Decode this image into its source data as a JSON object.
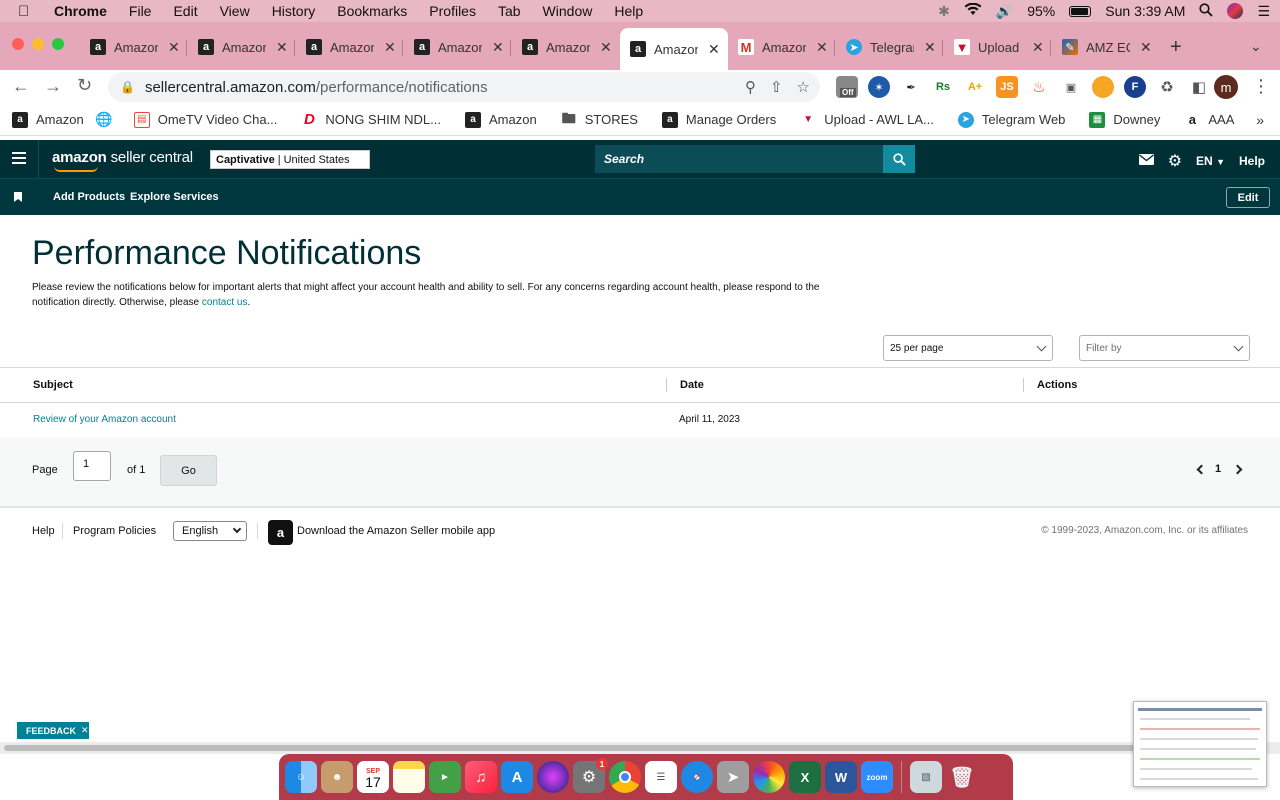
{
  "menubar": {
    "app": "Chrome",
    "items": [
      "File",
      "Edit",
      "View",
      "History",
      "Bookmarks",
      "Profiles",
      "Tab",
      "Window",
      "Help"
    ],
    "battery": "95%",
    "battery_level": 0.95,
    "clock": "Sun 3:39 AM"
  },
  "tabs": [
    {
      "title": "Amazon",
      "icon": "amazon-a-icon"
    },
    {
      "title": "Amazon",
      "icon": "amazon-a-icon"
    },
    {
      "title": "Amazon",
      "icon": "amazon-a-icon"
    },
    {
      "title": "Amazon",
      "icon": "amazon-a-icon"
    },
    {
      "title": "Amazon",
      "icon": "amazon-a-icon"
    },
    {
      "title": "Amazon",
      "icon": "amazon-a-icon",
      "active": true
    },
    {
      "title": "Amazon",
      "icon": "gmail-icon"
    },
    {
      "title": "Telegram",
      "icon": "telegram-icon"
    },
    {
      "title": "Upload",
      "icon": "upload-icon"
    },
    {
      "title": "AMZ EC",
      "icon": "amz-ec-icon"
    }
  ],
  "omnibox": {
    "host": "sellercentral.amazon.com",
    "path": "/performance/notifications"
  },
  "extensions": {
    "off_badge": "Off",
    "rs_label": "Rs",
    "js_label": "JS",
    "avatar_letter": "m"
  },
  "bookmarks": [
    {
      "label": "Amazon",
      "icon": "amazon-a-icon"
    },
    {
      "label": "",
      "icon": "globe-icon"
    },
    {
      "label": "OmeTV Video Cha...",
      "icon": "tv-icon"
    },
    {
      "label": "NONG SHIM NDL...",
      "icon": "pinterest-icon"
    },
    {
      "label": "Amazon",
      "icon": "amazon-a-icon"
    },
    {
      "label": "STORES",
      "icon": "folder-icon"
    },
    {
      "label": "Manage Orders",
      "icon": "amazon-a-icon"
    },
    {
      "label": "Upload - AWL LA...",
      "icon": "upload-icon"
    },
    {
      "label": "Telegram Web",
      "icon": "telegram-icon"
    },
    {
      "label": "Downey",
      "icon": "sheets-icon"
    },
    {
      "label": "AAA",
      "icon": "amazon-smile-icon"
    }
  ],
  "header": {
    "logo_bold": "amazon",
    "logo_rest": " seller central",
    "store_name": "Captivative",
    "store_region": "| United States",
    "search_placeholder": "Search",
    "language": "EN",
    "help": "Help"
  },
  "subnav": {
    "items": [
      "Add Products",
      "Explore Services"
    ],
    "edit": "Edit"
  },
  "main": {
    "title": "Performance Notifications",
    "intro_text": "Please review the notifications below for important alerts that might affect your account health and ability to sell. For any concerns regarding account health, please respond to the notification directly. Otherwise, please ",
    "intro_link": "contact us",
    "intro_end": ".",
    "per_page": "25 per page",
    "filter_placeholder": "Filter by",
    "columns": [
      "Subject",
      "Date",
      "Actions"
    ],
    "rows": [
      {
        "subject": "Review of your Amazon account",
        "date": "April 11, 2023",
        "actions": ""
      }
    ],
    "pager": {
      "page_label": "Page",
      "page_value": "1",
      "of_label": "of 1",
      "go": "Go",
      "current": "1"
    }
  },
  "footer": {
    "help": "Help",
    "policies": "Program Policies",
    "language": "English",
    "app_text": "Download the Amazon Seller mobile app",
    "copyright": "© 1999-2023, Amazon.com, Inc. or its affiliates"
  },
  "feedback": "FEEDBACK",
  "dock": {
    "calendar_month": "SEP",
    "calendar_day": "17",
    "settings_badge": "1",
    "zoom_label": "zoom"
  },
  "colors": {
    "header_bg": "#002f36",
    "subnav_bg": "#00363d",
    "link": "#008296",
    "search_button": "#138b9e",
    "menubar_bg": "#e9b8c6",
    "tabstrip_bg": "#e5a8ba",
    "dock_bg": "#b23b4a"
  }
}
